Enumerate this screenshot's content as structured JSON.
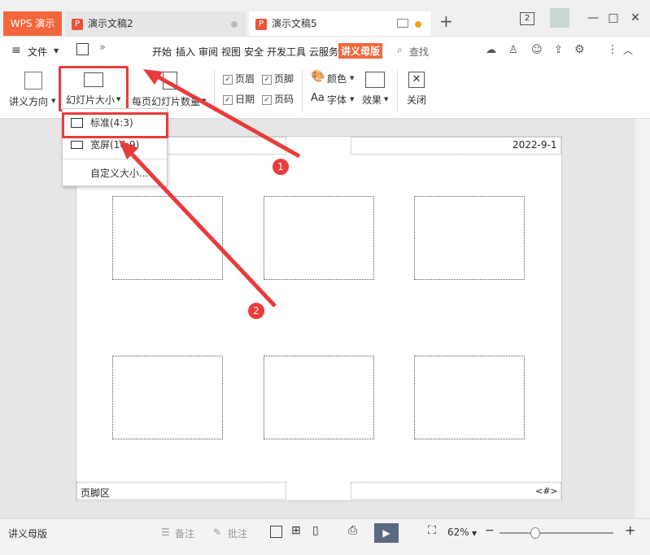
{
  "tabs": {
    "app": "WPS 演示",
    "doc1": "演示文稿2",
    "doc2": "演示文稿5",
    "counter": "2"
  },
  "menu": {
    "file": "文件",
    "items": [
      "开始",
      "插入",
      "审阅",
      "视图",
      "安全",
      "开发工具",
      "云服务"
    ],
    "active": "讲义母版",
    "search": "查找"
  },
  "ribbon": {
    "orientation": "讲义方向",
    "slide_size": "幻灯片大小",
    "per_page": "每页幻灯片数量",
    "header": "页眉",
    "footer": "页脚",
    "date": "日期",
    "page_num": "页码",
    "colors": "颜色",
    "fonts": "字体",
    "effects": "效果",
    "close": "关闭",
    "fonts_prefix": "Aa"
  },
  "dropdown": {
    "standard": "标准(4:3)",
    "wide": "宽屏(16:9)",
    "custom": "自定义大小..."
  },
  "slide": {
    "date": "2022-9-1",
    "footer": "页脚区",
    "page": "<#>"
  },
  "annotations": {
    "one": "1",
    "two": "2"
  },
  "status": {
    "view_name": "讲义母版",
    "notes": "备注",
    "comments": "批注",
    "zoom": "62%"
  },
  "colors": {
    "accent": "#f4673c",
    "highlight": "#e93b3b"
  }
}
